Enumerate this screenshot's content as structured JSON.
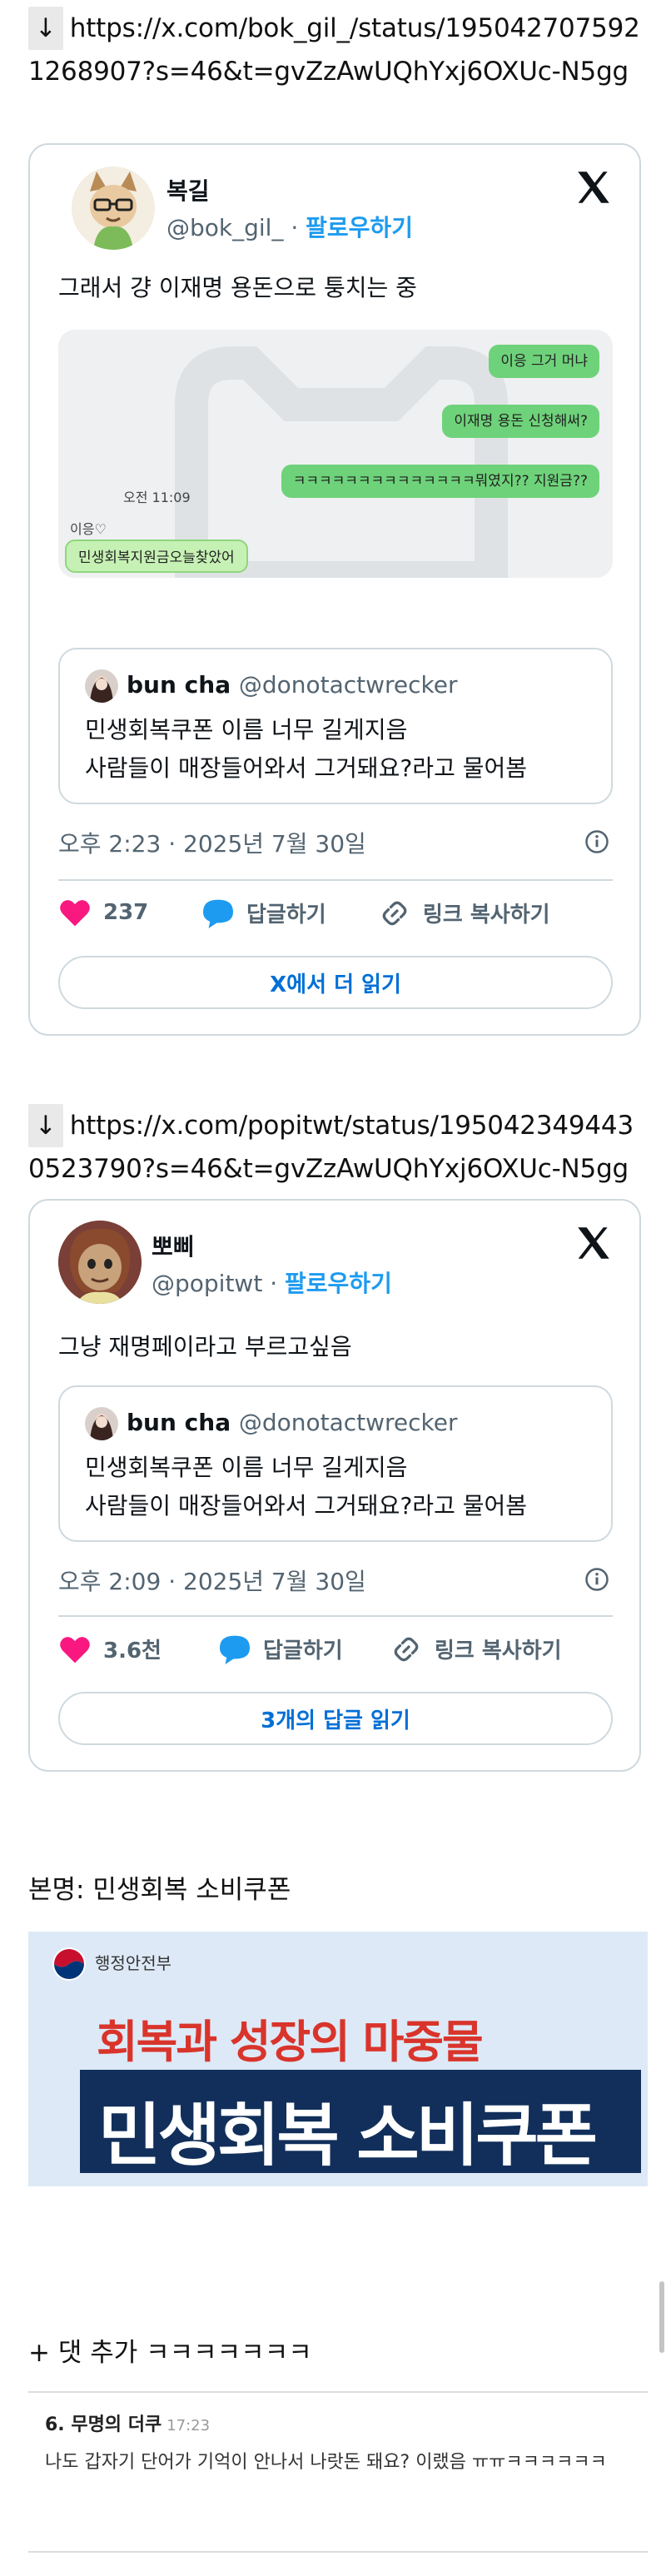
{
  "tweet1": {
    "url_arrow": "↓",
    "url": "https://x.com/bok_gil_/status/1950427075921268907?s=46&t=gvZzAwUQhYxj6OXUc-N5gg",
    "author_name": "복길",
    "author_handle": "@bok_gil_",
    "separator": " · ",
    "follow_label": "팔로우하기",
    "text": "그래서 걍 이재명 용돈으로 퉁치는 중",
    "chat": {
      "msg1": "이응 그거 머냐",
      "msg2": "이재명 용돈 신청해써?",
      "msg3": "ㅋㅋㅋㅋㅋㅋㅋㅋㅋㅋㅋㅋㅋㅋ뭐였지?? 지원금??",
      "time": "오전 11:09",
      "sender": "이응♡",
      "reply": "민생회복지원금오늘찾았어"
    },
    "quote": {
      "name": "bun cha",
      "handle": "@donotactwrecker",
      "line1": "민생회복쿠폰 이름 너무 길게지음",
      "line2": "사람들이 매장들어와서 그거돼요?라고 물어봄"
    },
    "timestamp": "오후 2:23 · 2025년 7월 30일",
    "likes": "237",
    "reply_label": "답글하기",
    "copy_label": "링크 복사하기",
    "read_more": "X에서 더 읽기"
  },
  "tweet2": {
    "url_arrow": "↓",
    "url": "https://x.com/popitwt/status/1950423494430523790?s=46&t=gvZzAwUQhYxj6OXUc-N5gg",
    "author_name": "뽀삐",
    "author_handle": "@popitwt",
    "separator": " · ",
    "follow_label": "팔로우하기",
    "text": "그냥 재명페이라고 부르고싶음",
    "quote": {
      "name": "bun cha",
      "handle": "@donotactwrecker",
      "line1": "민생회복쿠폰 이름 너무 길게지음",
      "line2": "사람들이 매장들어와서 그거돼요?라고 물어봄"
    },
    "timestamp": "오후 2:09 · 2025년 7월 30일",
    "likes": "3.6천",
    "reply_label": "답글하기",
    "copy_label": "링크 복사하기",
    "read_more": "3개의 답글 읽기"
  },
  "caption": "본명: 민생회복 소비쿠폰",
  "banner": {
    "ministry": "행정안전부",
    "headline": "회복과 성장의 마중물",
    "title": "민생회복 소비쿠폰"
  },
  "add_comment": "+ 댓 추가 ㅋㅋㅋㅋㅋㅋㅋ",
  "comment": {
    "number_author": "6. 무명의 더쿠",
    "time": "17:23",
    "body": "나도 갑자기 단어가 기억이 안나서 나랏돈 돼요? 이랬음 ㅠㅠㅋㅋㅋㅋㅋㅋ"
  },
  "colors": {
    "link_blue": "#1d9bf0",
    "like_pink": "#f91880",
    "banner_red": "#d9342b",
    "banner_navy": "#112f5a"
  }
}
